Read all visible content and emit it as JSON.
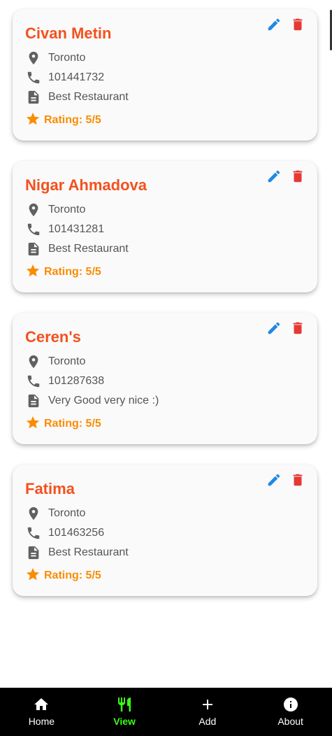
{
  "restaurants": [
    {
      "name": "Civan Metin",
      "city": "Toronto",
      "phone": "101441732",
      "description": "Best Restaurant",
      "rating": "Rating: 5/5"
    },
    {
      "name": "Nigar Ahmadova",
      "city": "Toronto",
      "phone": "101431281",
      "description": "Best Restaurant",
      "rating": "Rating: 5/5"
    },
    {
      "name": "Ceren's",
      "city": "Toronto",
      "phone": "101287638",
      "description": "Very Good very nice :)",
      "rating": "Rating: 5/5"
    },
    {
      "name": "Fatima",
      "city": "Toronto",
      "phone": "101463256",
      "description": "Best Restaurant",
      "rating": "Rating: 5/5"
    }
  ],
  "nav": {
    "items": [
      {
        "label": "Home",
        "icon": "home-icon"
      },
      {
        "label": "View",
        "icon": "restaurant-icon",
        "active": true
      },
      {
        "label": "Add",
        "icon": "add-icon"
      },
      {
        "label": "About",
        "icon": "info-icon"
      }
    ]
  },
  "colors": {
    "title": "#f4511e",
    "edit": "#1e88e5",
    "delete": "#e53935",
    "rating": "#fb8c00",
    "nav_active": "#39ff14",
    "nav_background": "#000000"
  }
}
